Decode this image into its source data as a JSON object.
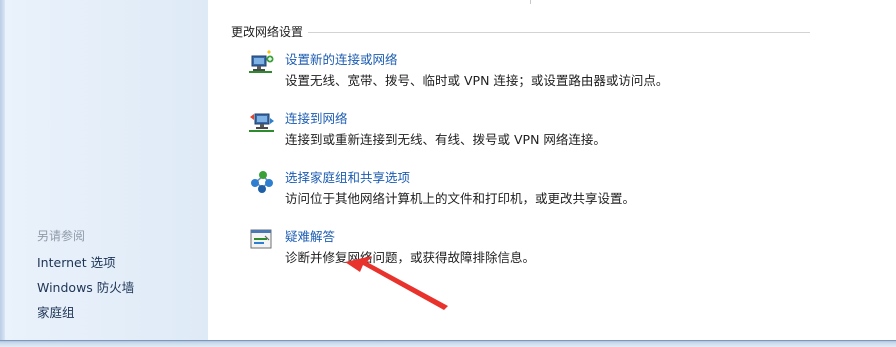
{
  "sidebar": {
    "see_also": "另请参阅",
    "links": [
      "Internet 选项",
      "Windows 防火墙",
      "家庭组"
    ]
  },
  "main": {
    "section_title": "更改网络设置",
    "tasks": [
      {
        "icon": "new-connection-icon",
        "title": "设置新的连接或网络",
        "desc": "设置无线、宽带、拨号、临时或 VPN 连接；或设置路由器或访问点。"
      },
      {
        "icon": "connect-network-icon",
        "title": "连接到网络",
        "desc": "连接到或重新连接到无线、有线、拨号或 VPN 网络连接。"
      },
      {
        "icon": "homegroup-sharing-icon",
        "title": "选择家庭组和共享选项",
        "desc": "访问位于其他网络计算机上的文件和打印机，或更改共享设置。"
      },
      {
        "icon": "troubleshoot-icon",
        "title": "疑难解答",
        "desc": "诊断并修复网络问题，或获得故障排除信息。"
      }
    ]
  },
  "annotation": {
    "arrow_color": "#e8322b"
  }
}
